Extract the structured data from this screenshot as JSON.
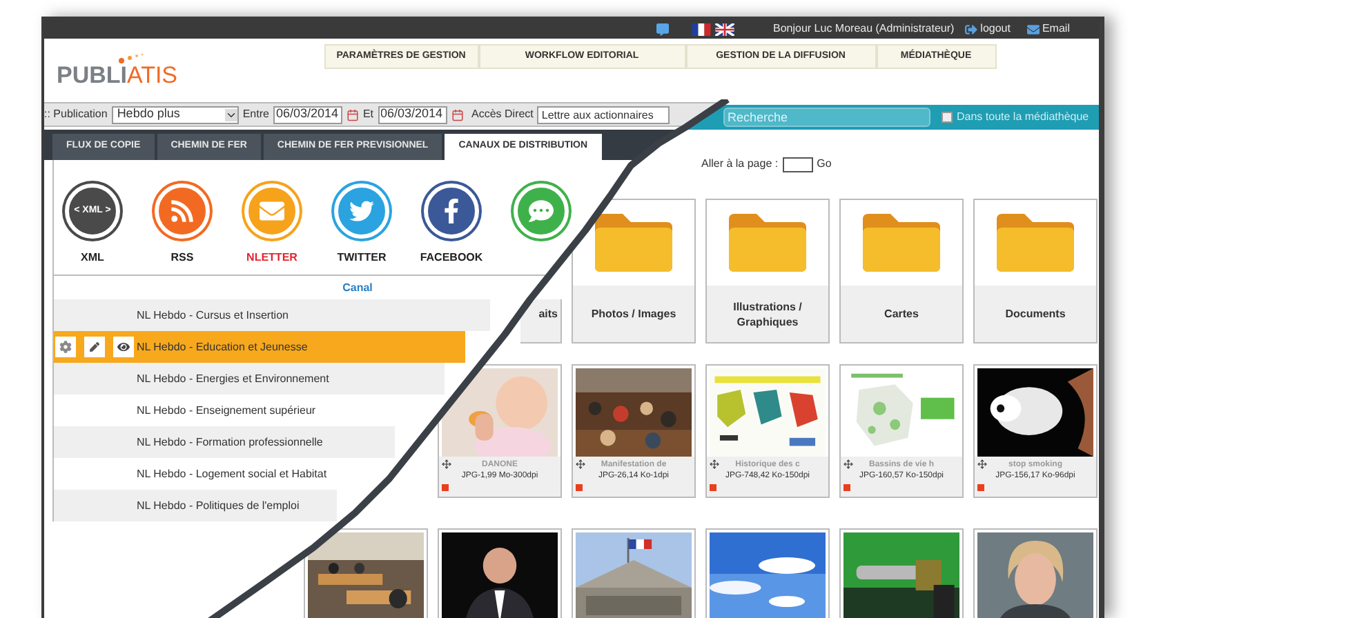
{
  "top_bar": {
    "greeting": "Bonjour Luc Moreau (Administrateur)",
    "logout": "logout",
    "email": "Email"
  },
  "logo": {
    "bold_part": "PUBLI",
    "light_part": "ATIS"
  },
  "main_menu": [
    "PARAMÈTRES DE GESTION",
    "WORKFLOW EDITORIAL",
    "GESTION DE LA DIFFUSION",
    "MÉDIATHÈQUE"
  ],
  "filter_bar": {
    "publication_label": ":: Publication",
    "publication": "Hebdo plus",
    "between_label": "Entre",
    "date_from": "06/03/2014",
    "and_label": "Et",
    "date_to": "06/03/2014",
    "direct_access_label": "Accès Direct",
    "direct_access": "Lettre aux actionnaires"
  },
  "search": {
    "placeholder": "Recherche",
    "scope_label": "Dans toute la médiathèque",
    "scope_checked": false
  },
  "tabs": [
    {
      "label": "FLUX DE COPIE",
      "selected": false
    },
    {
      "label": "CHEMIN DE FER",
      "selected": false
    },
    {
      "label": "CHEMIN DE FER PREVISIONNEL",
      "selected": false
    },
    {
      "label": "CANAUX DE DISTRIBUTION",
      "selected": true
    }
  ],
  "channels": [
    {
      "kind": "xml",
      "icon_text": "< XML >",
      "label": "XML",
      "selected": false
    },
    {
      "kind": "rss",
      "label": "RSS",
      "selected": false
    },
    {
      "kind": "newsletter",
      "label": "NLETTER",
      "selected": true
    },
    {
      "kind": "twitter",
      "label": "TWITTER",
      "selected": false
    },
    {
      "kind": "facebook",
      "label": "FACEBOOK",
      "selected": false
    },
    {
      "kind": "chat",
      "selected": false
    }
  ],
  "canal_heading": "Canal",
  "canal_rows": [
    {
      "name": "NL Hebdo - Cursus et Insertion",
      "selected": false
    },
    {
      "name": "NL Hebdo - Education et Jeunesse",
      "selected": true
    },
    {
      "name": "NL Hebdo - Energies et Environnement",
      "selected": false
    },
    {
      "name": "NL Hebdo - Enseignement supérieur",
      "selected": false
    },
    {
      "name": "NL Hebdo - Formation professionnelle",
      "selected": false
    },
    {
      "name": "NL Hebdo - Logement social et Habitat",
      "selected": false
    },
    {
      "name": "NL Hebdo - Politiques de l'emploi",
      "selected": false
    }
  ],
  "pagination": {
    "label": "Aller à la page :",
    "button": "Go"
  },
  "folders": [
    {
      "name": "aits"
    },
    {
      "name": "Photos / Images"
    },
    {
      "name": "Illustrations / Graphiques"
    },
    {
      "name": "Cartes"
    },
    {
      "name": "Documents"
    }
  ],
  "media": [
    {
      "kind": "picture",
      "title": "DANONE",
      "info": "JPG-1,99 Mo-300dpi"
    },
    {
      "kind": "picture",
      "title": "Manifestation de",
      "info": "JPG-26,14 Ko-1dpi"
    },
    {
      "kind": "picture",
      "title": "Historique des c",
      "info": "JPG-748,42 Ko-150dpi"
    },
    {
      "kind": "picture",
      "title": "Bassins de vie h",
      "info": "JPG-160,57 Ko-150dpi"
    },
    {
      "kind": "picture",
      "title": "stop smoking",
      "info": "JPG-156,17 Ko-96dpi"
    }
  ],
  "media_next_row": [
    {
      "kind": "picture"
    },
    {
      "kind": "picture"
    },
    {
      "kind": "picture"
    },
    {
      "kind": "picture"
    },
    {
      "kind": "picture"
    },
    {
      "kind": "picture"
    }
  ]
}
